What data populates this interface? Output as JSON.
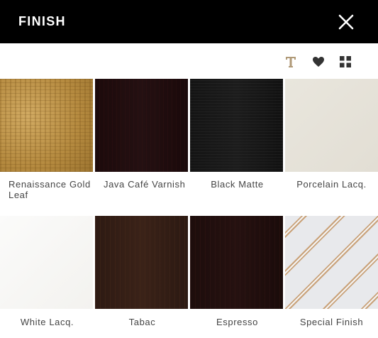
{
  "header": {
    "title": "FINISH",
    "close_icon": "close-icon"
  },
  "toolbar": {
    "icons": [
      "text-icon",
      "heart-icon",
      "grid-icon"
    ],
    "text_icon_color": "#b09a78",
    "icon_color": "#333333"
  },
  "finishes": [
    {
      "label": "Renaissance Gold Leaf",
      "color": "#b98e44"
    },
    {
      "label": "Java Café Varnish",
      "color": "#1f0c0e"
    },
    {
      "label": "Black Matte",
      "color": "#171717"
    },
    {
      "label": "Porcelain Lacq.",
      "color": "#e6e3da"
    },
    {
      "label": "White Lacq.",
      "color": "#f8f8f6"
    },
    {
      "label": "Tabac",
      "color": "#331e15"
    },
    {
      "label": "Espresso",
      "color": "#200f0e"
    },
    {
      "label": "Special Finish",
      "color": "#e8e9ec"
    }
  ]
}
